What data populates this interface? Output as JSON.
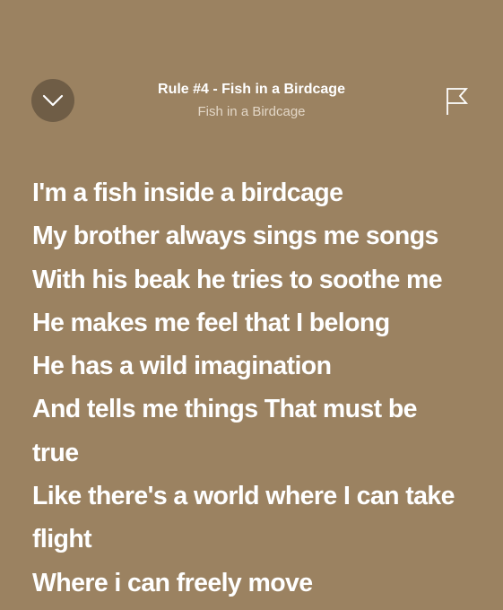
{
  "header": {
    "collapse_icon": "chevron-down-icon",
    "title": "Rule #4 - Fish in a Birdcage",
    "subtitle": "Fish in a Birdcage",
    "flag_icon": "flag-icon"
  },
  "lyrics": {
    "lines": [
      "I'm a fish inside a birdcage",
      "My brother always sings me songs",
      "With his beak he tries to soothe me",
      "He makes me feel that I belong",
      "He has a wild imagination",
      "And tells me things That must be",
      "true",
      "Like there's a world where I can take",
      "flight",
      "Where i can freely move"
    ]
  },
  "colors": {
    "background": "#9b8261",
    "button_bg": "#6f5d46",
    "text": "#ffffff",
    "subtext": "#e2d6c6"
  }
}
